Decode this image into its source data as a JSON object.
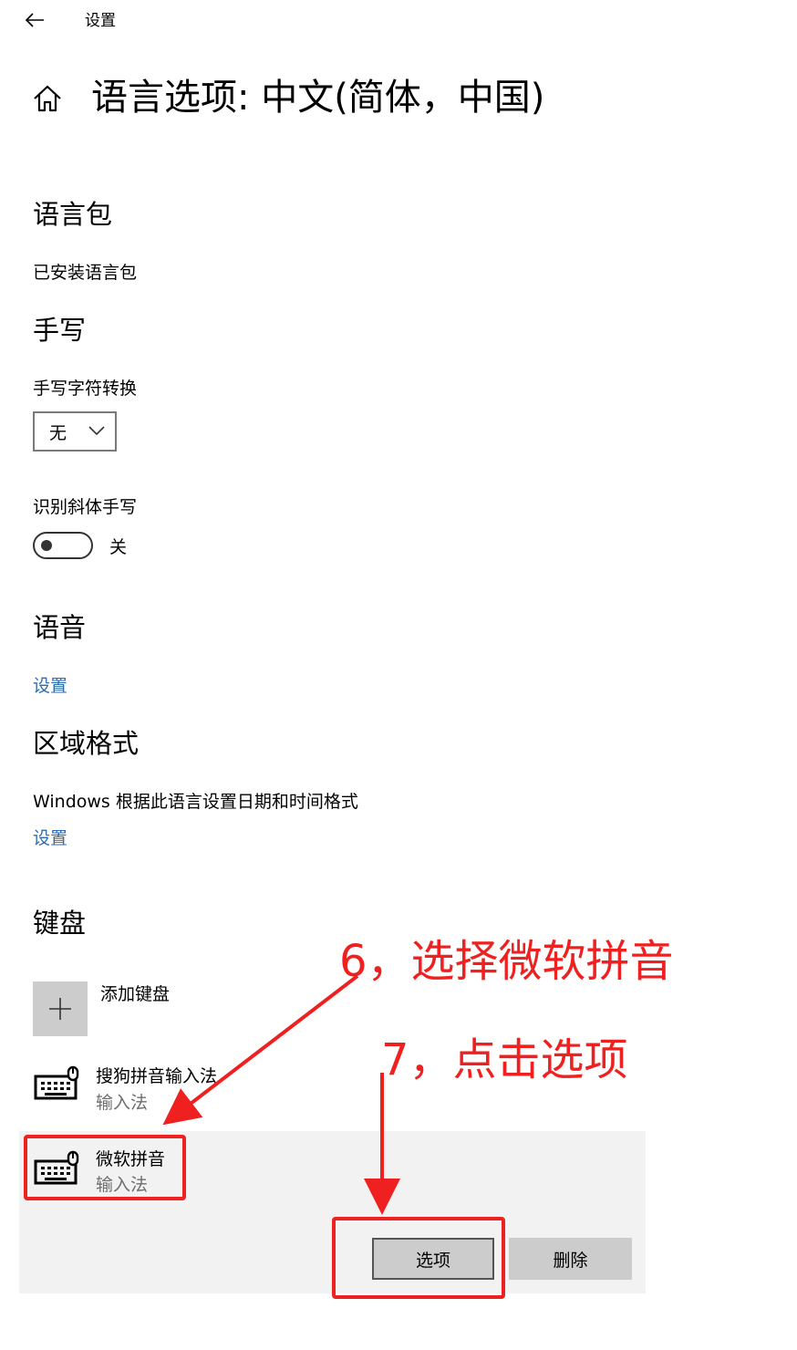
{
  "window": {
    "app_title": "设置",
    "back_icon": "arrow-left-icon",
    "home_icon": "home-icon"
  },
  "page": {
    "title": "语言选项: 中文(简体，中国)"
  },
  "language_pack": {
    "heading": "语言包",
    "status": "已安装语言包"
  },
  "handwriting": {
    "heading": "手写",
    "conversion_label": "手写字符转换",
    "conversion_value": "无",
    "italic_label": "识别斜体手写",
    "italic_toggle_state": "关"
  },
  "speech": {
    "heading": "语音",
    "settings_link": "设置"
  },
  "region": {
    "heading": "区域格式",
    "description": "Windows 根据此语言设置日期和时间格式",
    "settings_link": "设置"
  },
  "keyboards": {
    "heading": "键盘",
    "add_label": "添加键盘",
    "items": [
      {
        "name": "搜狗拼音输入法",
        "type": "输入法"
      },
      {
        "name": "微软拼音",
        "type": "输入法"
      }
    ],
    "options_button": "选项",
    "delete_button": "删除"
  },
  "annotations": {
    "step6": "6，选择微软拼音",
    "step7": "7，点击选项",
    "color": "#ee2020"
  },
  "colors": {
    "link": "#2a6cb5",
    "selected_bg": "#f2f2f2",
    "button_bg": "#cccccc"
  }
}
